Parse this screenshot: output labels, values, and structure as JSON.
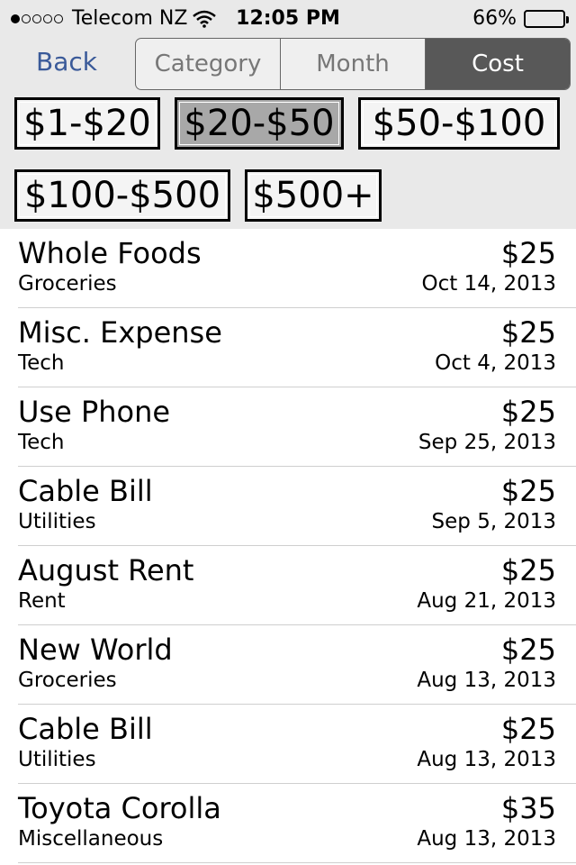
{
  "status_bar": {
    "carrier": "Telecom NZ",
    "time": "12:05 PM",
    "battery": "66%",
    "battery_level": 0.66,
    "signal_bars": 1,
    "signal_total": 5
  },
  "nav": {
    "back_label": "Back",
    "segments": [
      {
        "label": "Category",
        "active": false
      },
      {
        "label": "Month",
        "active": false
      },
      {
        "label": "Cost",
        "active": true
      }
    ]
  },
  "cost_filters": [
    {
      "label": "$1-$20",
      "active": false
    },
    {
      "label": "$20-$50",
      "active": true
    },
    {
      "label": "$50-$100",
      "active": false
    },
    {
      "label": "$100-$500",
      "active": false
    },
    {
      "label": "$500+",
      "active": false
    }
  ],
  "expenses": [
    {
      "name": "Whole Foods",
      "category": "Groceries",
      "amount": "$25",
      "date": "Oct 14, 2013"
    },
    {
      "name": "Misc. Expense",
      "category": "Tech",
      "amount": "$25",
      "date": "Oct 4, 2013"
    },
    {
      "name": "Use Phone",
      "category": "Tech",
      "amount": "$25",
      "date": "Sep 25, 2013"
    },
    {
      "name": "Cable Bill",
      "category": "Utilities",
      "amount": "$25",
      "date": "Sep 5, 2013"
    },
    {
      "name": "August Rent",
      "category": "Rent",
      "amount": "$25",
      "date": "Aug 21, 2013"
    },
    {
      "name": "New World",
      "category": "Groceries",
      "amount": "$25",
      "date": "Aug 13, 2013"
    },
    {
      "name": "Cable Bill",
      "category": "Utilities",
      "amount": "$25",
      "date": "Aug 13, 2013"
    },
    {
      "name": "Toyota Corolla",
      "category": "Miscellaneous",
      "amount": "$35",
      "date": "Aug 13, 2013"
    }
  ]
}
